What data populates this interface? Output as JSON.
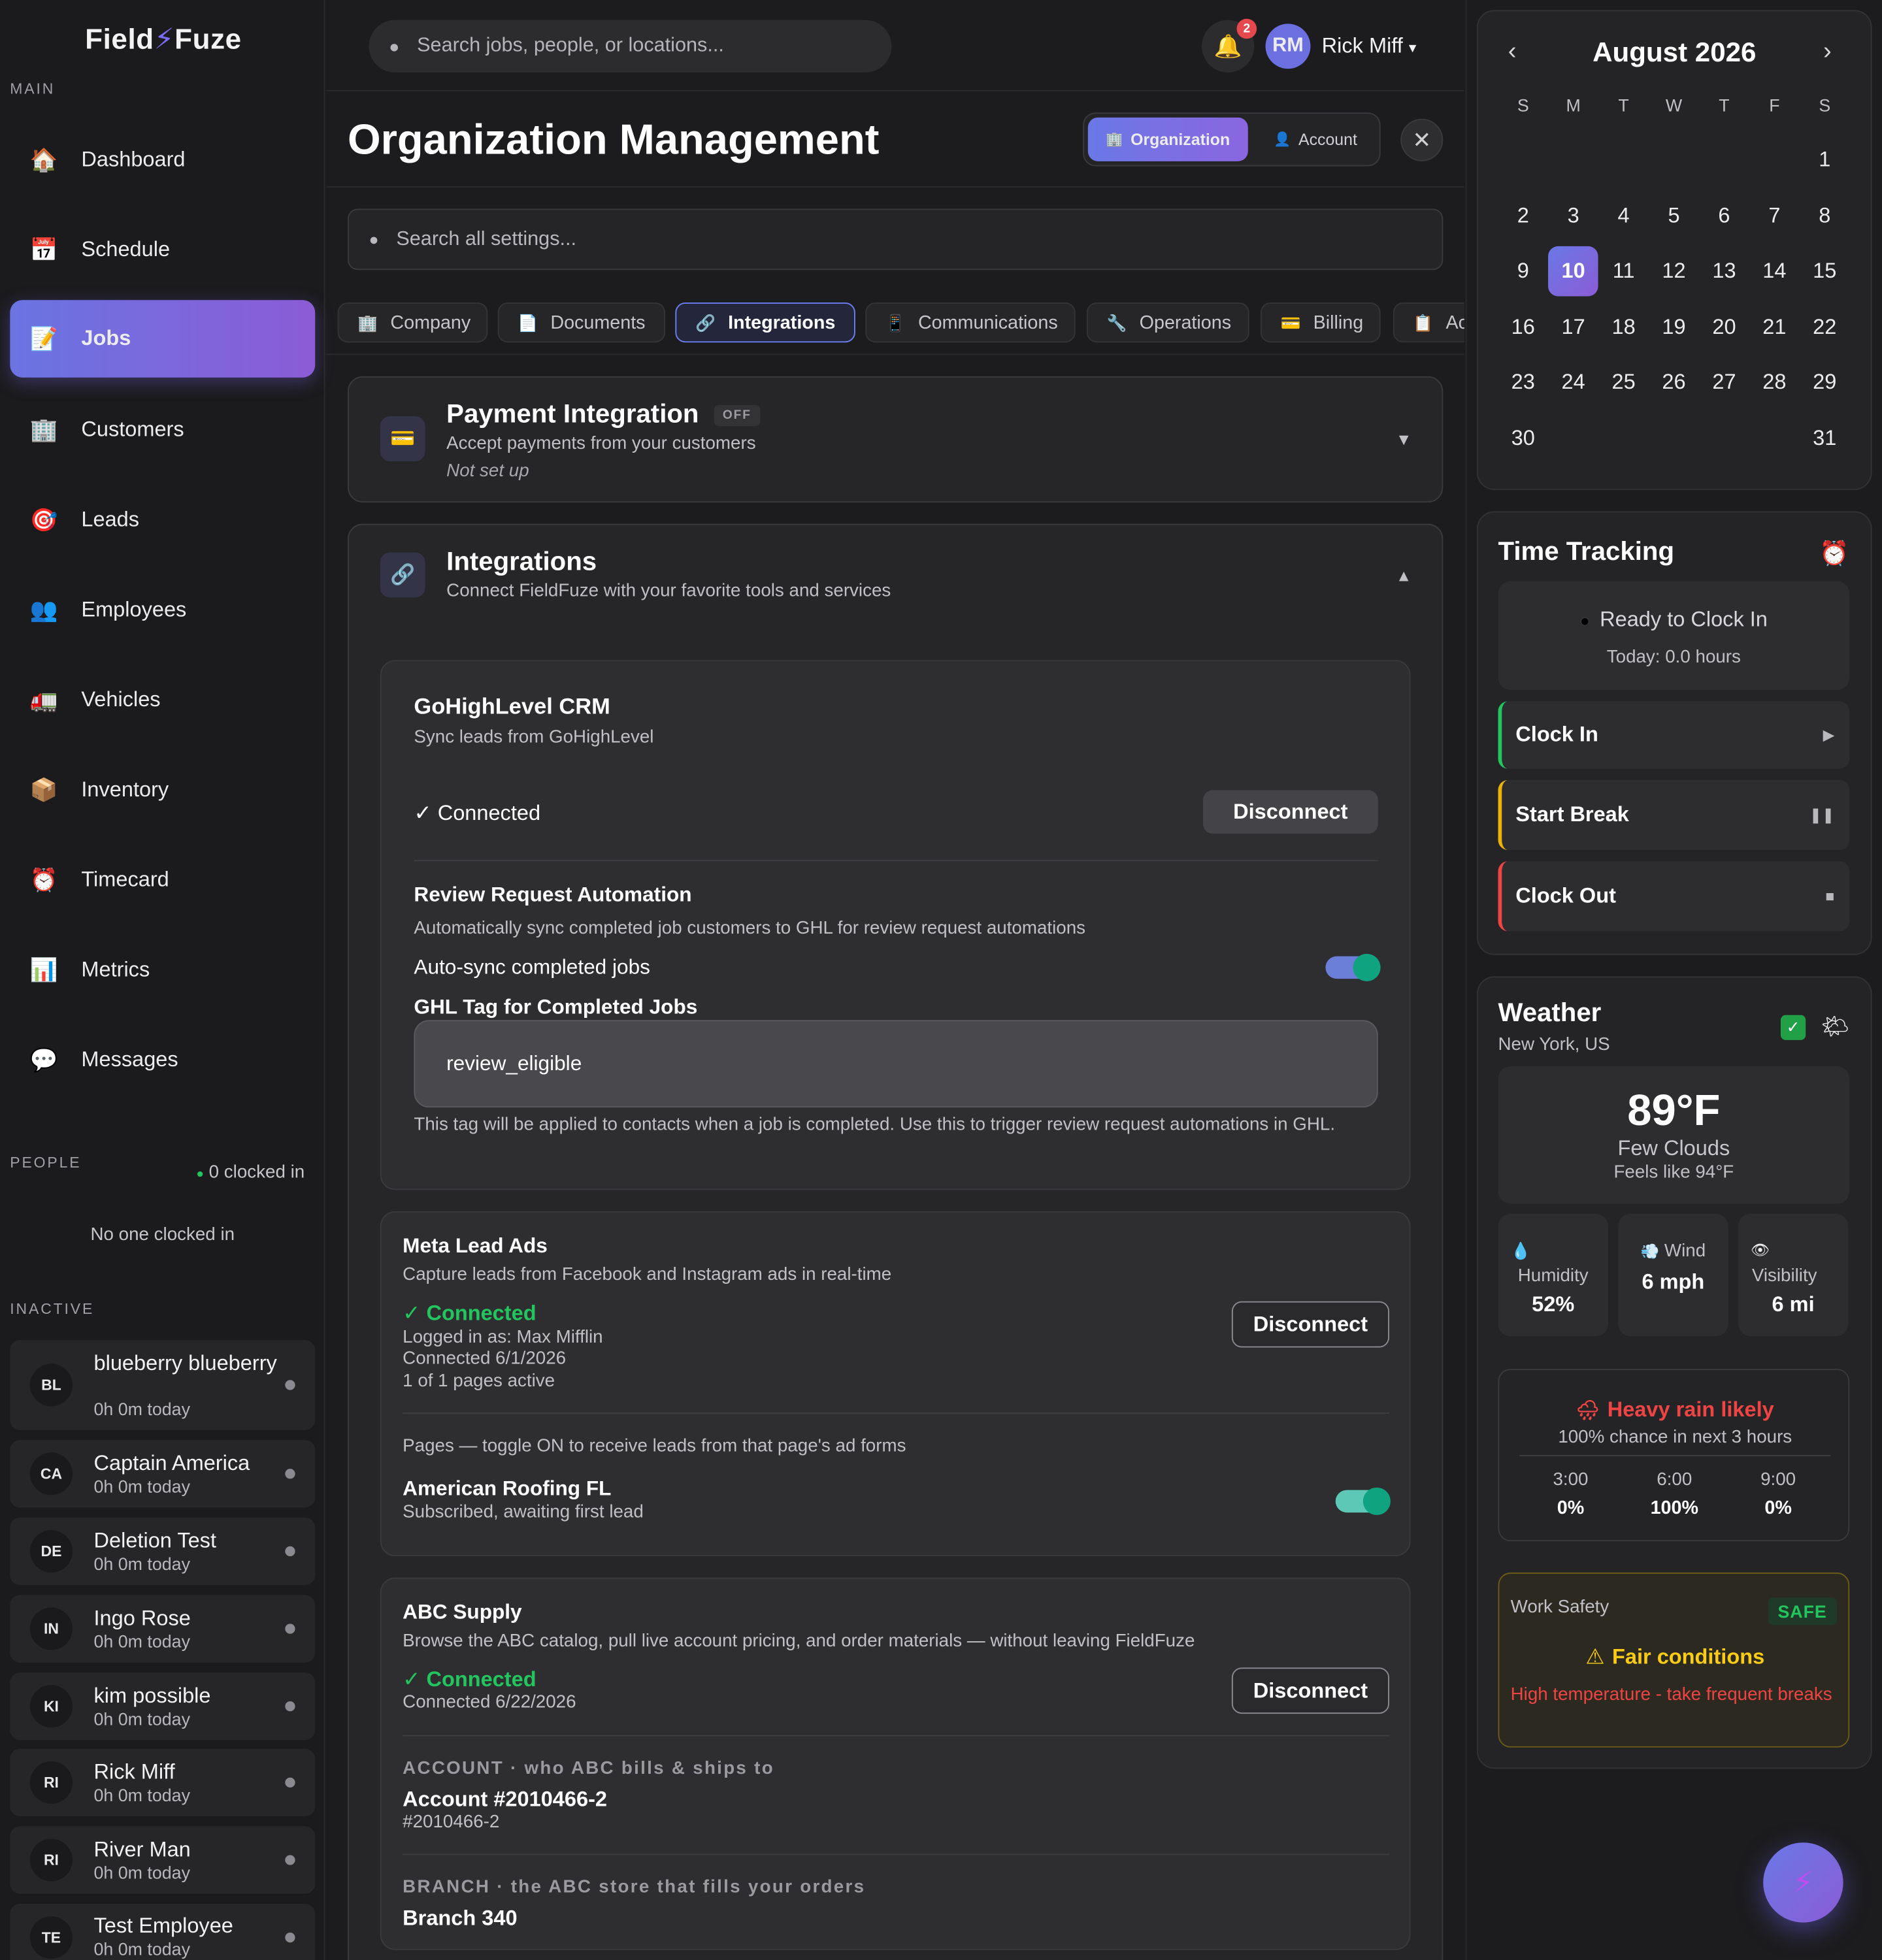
{
  "app": {
    "logo_left": "Field",
    "logo_bolt": "⚡",
    "logo_right": "Fuze"
  },
  "sidebar": {
    "main_label": "MAIN",
    "items": [
      {
        "label": "Dashboard",
        "icon": "🏠"
      },
      {
        "label": "Schedule",
        "icon": "📅"
      },
      {
        "label": "Jobs",
        "icon": "📝",
        "active": true
      },
      {
        "label": "Customers",
        "icon": "🏢"
      },
      {
        "label": "Leads",
        "icon": "🎯"
      },
      {
        "label": "Employees",
        "icon": "👥"
      },
      {
        "label": "Vehicles",
        "icon": "🚛"
      },
      {
        "label": "Inventory",
        "icon": "📦"
      },
      {
        "label": "Timecard",
        "icon": "⏰"
      },
      {
        "label": "Metrics",
        "icon": "📊"
      },
      {
        "label": "Messages",
        "icon": "💬"
      }
    ],
    "people_label": "PEOPLE",
    "clocked_in": "0 clocked in",
    "no_one": "No one clocked in",
    "inactive_label": "INACTIVE",
    "employees": [
      {
        "initials": "BL",
        "name": "blueberry blueberry",
        "time": "0h 0m today"
      },
      {
        "initials": "CA",
        "name": "Captain America",
        "time": "0h 0m today"
      },
      {
        "initials": "DE",
        "name": "Deletion Test",
        "time": "0h 0m today"
      },
      {
        "initials": "IN",
        "name": "Ingo Rose",
        "time": "0h 0m today"
      },
      {
        "initials": "KI",
        "name": "kim possible",
        "time": "0h 0m today"
      },
      {
        "initials": "RI",
        "name": "Rick Miff",
        "time": "0h 0m today"
      },
      {
        "initials": "RI",
        "name": "River Man",
        "time": "0h 0m today"
      },
      {
        "initials": "TE",
        "name": "Test Employee",
        "time": "0h 0m today"
      }
    ]
  },
  "topbar": {
    "search_placeholder": "Search jobs, people, or locations...",
    "notif_count": "2",
    "avatar": "RM",
    "user_name": "Rick Miff",
    "caret": "▾"
  },
  "page": {
    "title": "Organization Management",
    "seg_org": "Organization",
    "seg_account": "Account",
    "settings_placeholder": "Search all settings...",
    "tabs": [
      {
        "label": "Company",
        "icon": "🏢"
      },
      {
        "label": "Documents",
        "icon": "📄"
      },
      {
        "label": "Integrations",
        "icon": "🔗",
        "active": true
      },
      {
        "label": "Communications",
        "icon": "📱"
      },
      {
        "label": "Operations",
        "icon": "🔧"
      },
      {
        "label": "Billing",
        "icon": "💳"
      },
      {
        "label": "Ac",
        "icon": "📋"
      }
    ]
  },
  "payment": {
    "title": "Payment Integration",
    "badge": "OFF",
    "desc": "Accept payments from your customers",
    "status": "Not set up",
    "chevron": "▼"
  },
  "integrations": {
    "title": "Integrations",
    "desc": "Connect FieldFuze with your favorite tools and services",
    "chevron": "▲",
    "ghl": {
      "title": "GoHighLevel CRM",
      "desc": "Sync leads from GoHighLevel",
      "status": "✓ Connected",
      "disconnect": "Disconnect",
      "review_title": "Review Request Automation",
      "review_desc": "Automatically sync completed job customers to GHL for review request automations",
      "autosync_label": "Auto-sync completed jobs",
      "autosync_on": true,
      "tag_label": "GHL Tag for Completed Jobs",
      "tag_value": "review_eligible",
      "tag_help": "This tag will be applied to contacts when a job is completed. Use this to trigger review request automations in GHL."
    },
    "meta": {
      "title": "Meta Lead Ads",
      "desc": "Capture leads from Facebook and Instagram ads in real-time",
      "status": "✓ Connected",
      "logged_in": "Logged in as: Max Mifflin",
      "connected_date": "Connected 6/1/2026",
      "pages_active": "1 of 1 pages active",
      "disconnect": "Disconnect",
      "pages_help": "Pages — toggle ON to receive leads from that page's ad forms",
      "page_name": "American Roofing FL",
      "page_status": "Subscribed, awaiting first lead",
      "page_on": true
    },
    "abc": {
      "title": "ABC Supply",
      "desc": "Browse the ABC catalog, pull live account pricing, and order materials — without leaving FieldFuze",
      "status": "✓ Connected",
      "connected_date": "Connected 6/22/2026",
      "disconnect": "Disconnect",
      "account_caption": "ACCOUNT · who ABC bills & ships to",
      "account_value": "Account #2010466-2",
      "account_sub": "#2010466-2",
      "branch_caption": "BRANCH · the ABC store that fills your orders",
      "branch_value": "Branch 340"
    }
  },
  "calendar": {
    "month": "August 2026",
    "prev": "‹",
    "next": "›",
    "weekdays": [
      "S",
      "M",
      "T",
      "W",
      "T",
      "F",
      "S"
    ],
    "days": [
      [
        "",
        "",
        "",
        "",
        "",
        "",
        "1"
      ],
      [
        "2",
        "3",
        "4",
        "5",
        "6",
        "7",
        "8"
      ],
      [
        "9",
        "10",
        "11",
        "12",
        "13",
        "14",
        "15"
      ],
      [
        "16",
        "17",
        "18",
        "19",
        "20",
        "21",
        "22"
      ],
      [
        "23",
        "24",
        "25",
        "26",
        "27",
        "28",
        "29"
      ],
      [
        "30",
        "",
        "",
        "",
        "",
        "",
        "31"
      ]
    ],
    "selected": "10"
  },
  "time_tracking": {
    "title": "Time Tracking",
    "icon": "⏰",
    "status": "Ready to Clock In",
    "today": "Today: 0.0 hours",
    "clock_in": "Clock In",
    "start_break": "Start Break",
    "clock_out": "Clock Out",
    "colors": {
      "clock_in": "#22c55e",
      "start_break": "#eab308",
      "clock_out": "#ef4444"
    }
  },
  "weather": {
    "title": "Weather",
    "location": "New York, US",
    "temp": "89°F",
    "condition": "Few Clouds",
    "feels": "Feels like 94°F",
    "humidity_label": "Humidity",
    "humidity": "52%",
    "wind_label": "Wind",
    "wind": "6 mph",
    "visibility_label": "Visibility",
    "visibility": "6 mi",
    "alert": "Heavy rain likely",
    "alert_sub": "100% chance in next 3 hours",
    "hours": [
      {
        "time": "3:00",
        "pct": "0%"
      },
      {
        "time": "6:00",
        "pct": "100%"
      },
      {
        "time": "9:00",
        "pct": "0%"
      }
    ],
    "safety_label": "Work Safety",
    "safety_badge": "SAFE",
    "safety_status": "Fair conditions",
    "safety_note": "High temperature - take frequent breaks"
  }
}
